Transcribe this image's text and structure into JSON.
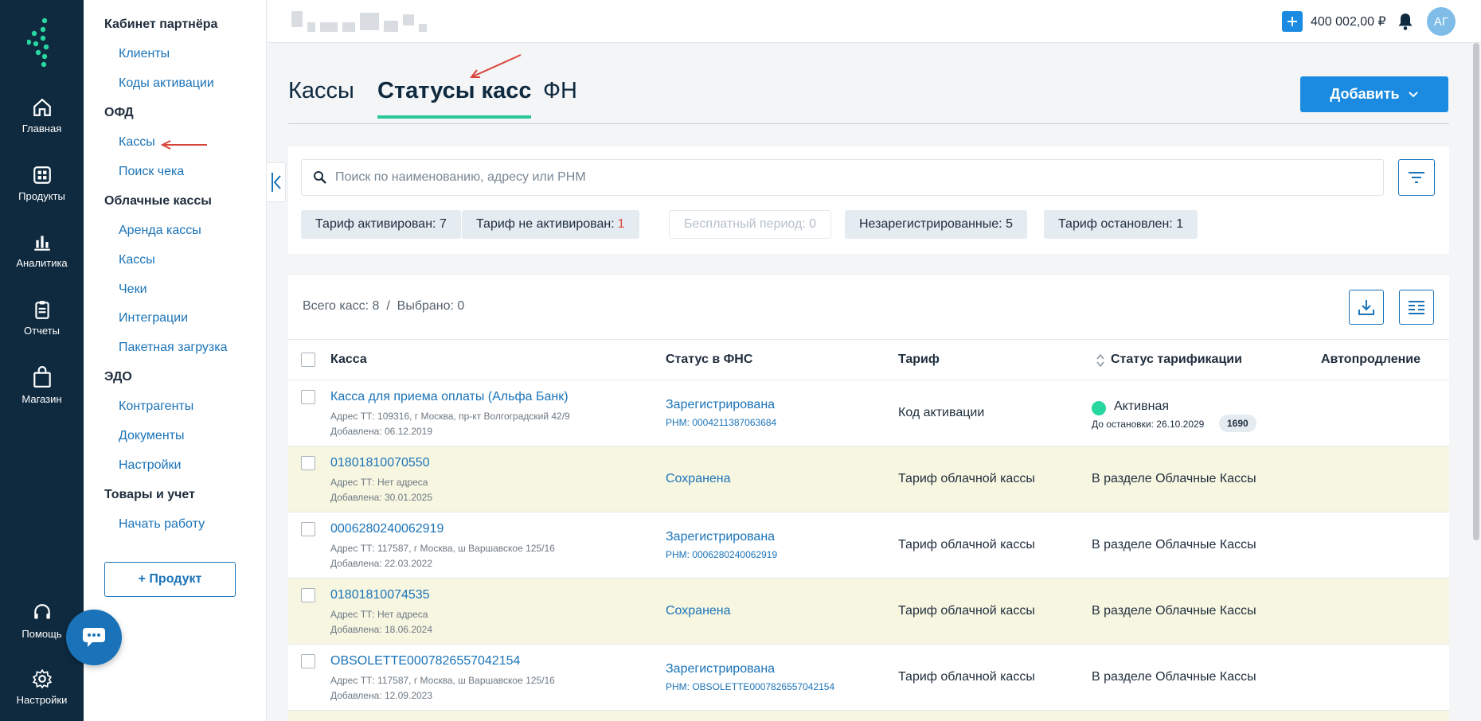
{
  "rail": {
    "items": [
      {
        "label": "Главная"
      },
      {
        "label": "Продукты"
      },
      {
        "label": "Аналитика"
      },
      {
        "label": "Отчеты"
      },
      {
        "label": "Магазин"
      },
      {
        "label": "Помощь"
      },
      {
        "label": "Настройки"
      }
    ]
  },
  "sidebar": {
    "groups": [
      {
        "title": "Кабинет партнёра",
        "items": [
          "Клиенты",
          "Коды активации"
        ]
      },
      {
        "title": "ОФД",
        "items": [
          "Кассы",
          "Поиск чека"
        ]
      },
      {
        "title": "Облачные кассы",
        "items": [
          "Аренда кассы",
          "Кассы",
          "Чеки",
          "Интеграции",
          "Пакетная загрузка"
        ]
      },
      {
        "title": "ЭДО",
        "items": [
          "Контрагенты",
          "Документы",
          "Настройки"
        ]
      },
      {
        "title": "Товары и учет",
        "items": [
          "Начать работу"
        ]
      }
    ],
    "product_button": "+ Продукт"
  },
  "header": {
    "balance": "400 002,00 ₽",
    "avatar_initials": "АГ"
  },
  "tabs": [
    "Кассы",
    "Статусы касс",
    "ФН"
  ],
  "add_button": "Добавить",
  "search": {
    "placeholder": "Поиск по наименованию, адресу или РНМ"
  },
  "chips": [
    {
      "label": "Тариф активирован:",
      "count": "7"
    },
    {
      "label": "Тариф не активирован:",
      "count": "1"
    },
    {
      "label": "Бесплатный период:",
      "count": "0"
    },
    {
      "label": "Незарегистрированные:",
      "count": "5"
    },
    {
      "label": "Тариф остановлен:",
      "count": "1"
    }
  ],
  "table": {
    "summary": "Всего касс: 8  /  Выбрано: 0",
    "columns": [
      "Касса",
      "Статус в ФНС",
      "Тариф",
      "Статус тарификации",
      "Автопродление"
    ],
    "rows": [
      {
        "name": "Касса для приема оплаты (Альфа Банк)",
        "address": "Адрес ТТ: 109316, г Москва, пр-кт Волгоградский 42/9",
        "added": "Добавлена: 06.12.2019",
        "fns": "Зарегистрирована",
        "rnm": "РНМ: 0004211387063684",
        "tariff": "Код активации",
        "status": "Активная",
        "until": "До остановки: 26.10.2029",
        "badge": "1690"
      },
      {
        "name": "01801810070550",
        "address": "Адрес ТТ: Нет адреса",
        "added": "Добавлена: 30.01.2025",
        "fns": "Сохранена",
        "rnm": "",
        "tariff": "Тариф облачной кассы",
        "status": "В разделе Облачные Кассы"
      },
      {
        "name": "0006280240062919",
        "address": "Адрес ТТ: 117587, г Москва, ш Варшавское 125/16",
        "added": "Добавлена: 22.03.2022",
        "fns": "Зарегистрирована",
        "rnm": "РНМ: 0006280240062919",
        "tariff": "Тариф облачной кассы",
        "status": "В разделе Облачные Кассы"
      },
      {
        "name": "01801810074535",
        "address": "Адрес ТТ: Нет адреса",
        "added": "Добавлена: 18.06.2024",
        "fns": "Сохранена",
        "rnm": "",
        "tariff": "Тариф облачной кассы",
        "status": "В разделе Облачные Кассы"
      },
      {
        "name": "OBSOLETTE0007826557042154",
        "address": "Адрес ТТ: 117587, г Москва, ш Варшавское 125/16",
        "added": "Добавлена: 12.09.2023",
        "fns": "Зарегистрирована",
        "rnm": "РНМ: OBSOLETTE0007826557042154",
        "tariff": "Тариф облачной кассы",
        "status": "В разделе Облачные Кассы"
      }
    ]
  },
  "colors": {
    "rail": "#0f2a3f",
    "accent": "#1a8be0",
    "link": "#1a73b8",
    "active_tab": "#28c79a",
    "status_active": "#28d6a0",
    "highlight_row": "#f7f6e1",
    "annotation_arrow": "#d9443a"
  }
}
